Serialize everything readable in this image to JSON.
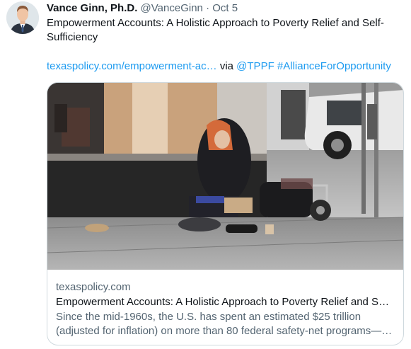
{
  "author": {
    "name": "Vance Ginn, Ph.D.",
    "handle": "@VanceGinn",
    "separator": "·",
    "date": "Oct 5"
  },
  "tweet": {
    "text": "Empowerment Accounts: A Holistic Approach to Poverty Relief and Self-Sufficiency",
    "link_text": "texaspolicy.com/empowerment-ac…",
    "via": "via",
    "mention": "@TPPF",
    "hashtag": "#AllianceForOpportunity"
  },
  "card": {
    "image_icon": "photo-woman-sitting-on-sidewalk",
    "domain": "texaspolicy.com",
    "title": "Empowerment Accounts: A Holistic Approach to Poverty Relief and S…",
    "description": "Since the mid-1960s, the U.S. has spent an estimated $25 trillion (adjusted for inflation) on more than 80 federal safety-net programs—…"
  },
  "colors": {
    "link": "#1d9bf0",
    "secondary_text": "#536471",
    "primary_text": "#0f1419",
    "border": "#cfd9de"
  }
}
